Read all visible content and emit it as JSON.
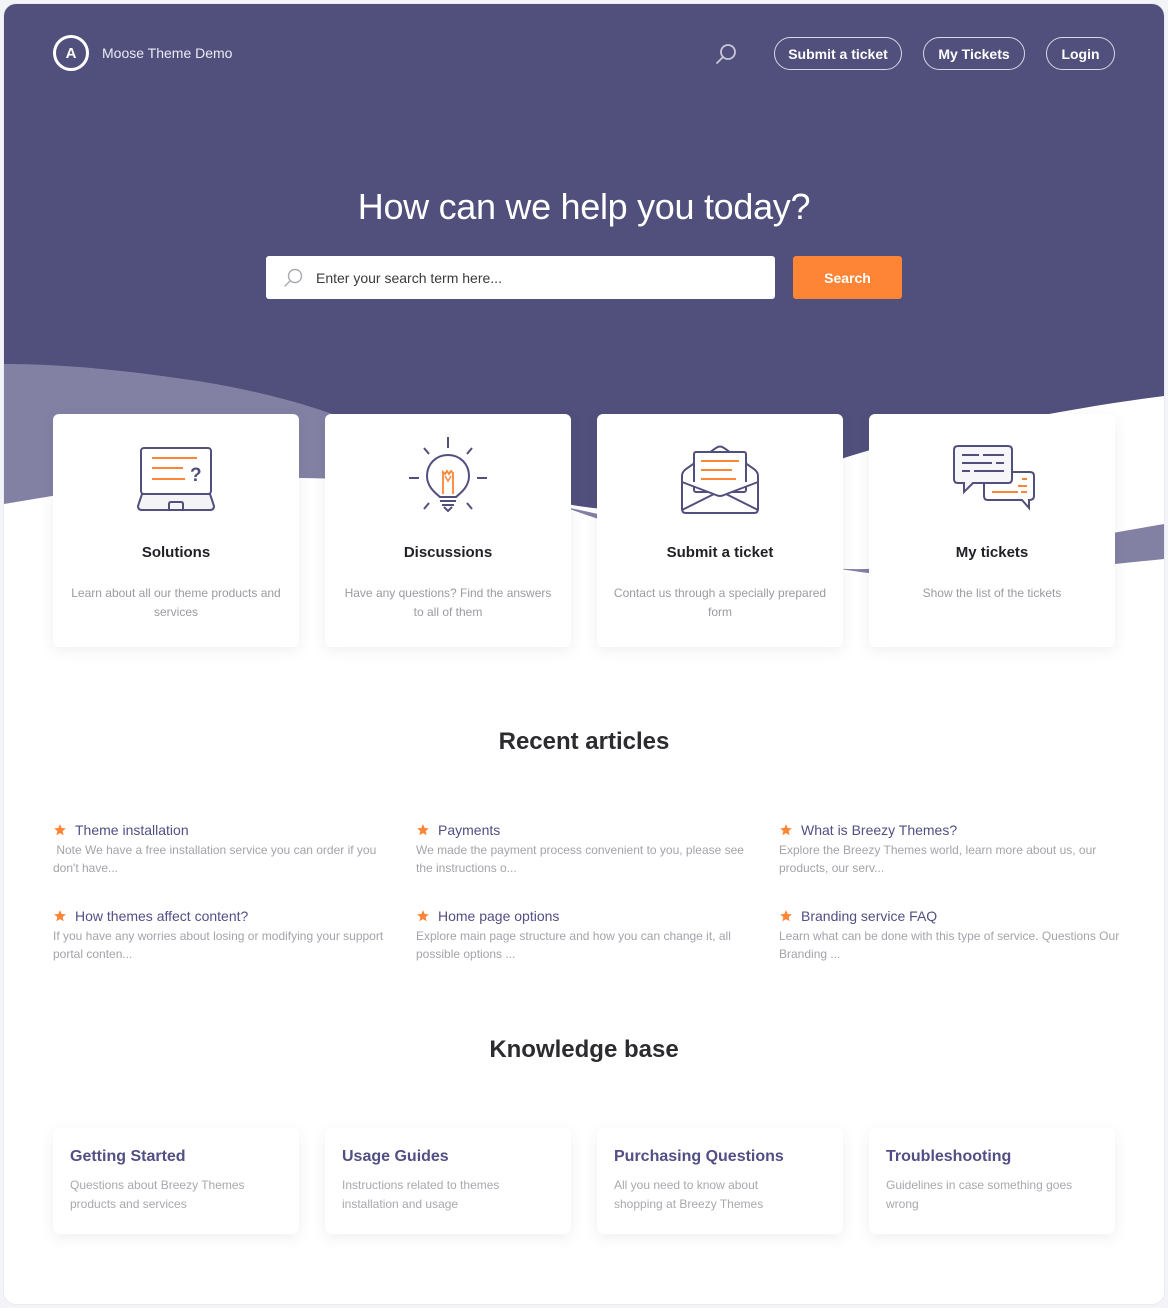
{
  "brand": {
    "logo_letter": "A",
    "name": "Moose Theme Demo"
  },
  "colors": {
    "header_bg": "#514f7c",
    "wave_light": "#8381a3",
    "accent_orange": "#fd8535",
    "link_purple": "#514f84"
  },
  "nav": {
    "search_icon": "search-icon",
    "buttons": [
      {
        "label": "Submit a ticket"
      },
      {
        "label": "My Tickets"
      },
      {
        "label": "Login"
      }
    ]
  },
  "hero": {
    "title": "How can we help you today?",
    "search_placeholder": "Enter your search term here...",
    "search_value": "",
    "search_button": "Search"
  },
  "categories": [
    {
      "icon": "laptop-question-icon",
      "title": "Solutions",
      "description": "Learn about all our theme products and services"
    },
    {
      "icon": "lightbulb-icon",
      "title": "Discussions",
      "description": "Have any questions? Find the answers to all of them"
    },
    {
      "icon": "open-envelope-icon",
      "title": "Submit a ticket",
      "description": "Contact us through a specially prepared form"
    },
    {
      "icon": "chat-bubbles-icon",
      "title": "My tickets",
      "description": "Show the list of the tickets"
    }
  ],
  "recent_articles": {
    "heading": "Recent articles",
    "items": [
      {
        "title": "Theme installation",
        "excerpt": " Note We have a free installation service you can order if you don't have..."
      },
      {
        "title": "Payments",
        "excerpt": "We made the payment process convenient to you, please see the instructions o..."
      },
      {
        "title": "What is Breezy Themes?",
        "excerpt": "Explore the Breezy Themes world, learn more about us, our products, our serv..."
      },
      {
        "title": "How themes affect content?",
        "excerpt": "If you have any worries about losing or modifying your support portal conten..."
      },
      {
        "title": "Home page options",
        "excerpt": "Explore main page structure and how you can change it, all possible options ..."
      },
      {
        "title": "Branding service FAQ",
        "excerpt": "Learn what can be done with this type of service. Questions Our Branding ..."
      }
    ]
  },
  "knowledge_base": {
    "heading": "Knowledge base",
    "items": [
      {
        "title": "Getting Started",
        "description": "Questions about Breezy Themes products and services"
      },
      {
        "title": "Usage Guides",
        "description": "Instructions related to themes installation and usage"
      },
      {
        "title": "Purchasing Questions",
        "description": "All you need to know about shopping at Breezy Themes"
      },
      {
        "title": "Troubleshooting",
        "description": "Guidelines in case something goes wrong"
      }
    ]
  }
}
